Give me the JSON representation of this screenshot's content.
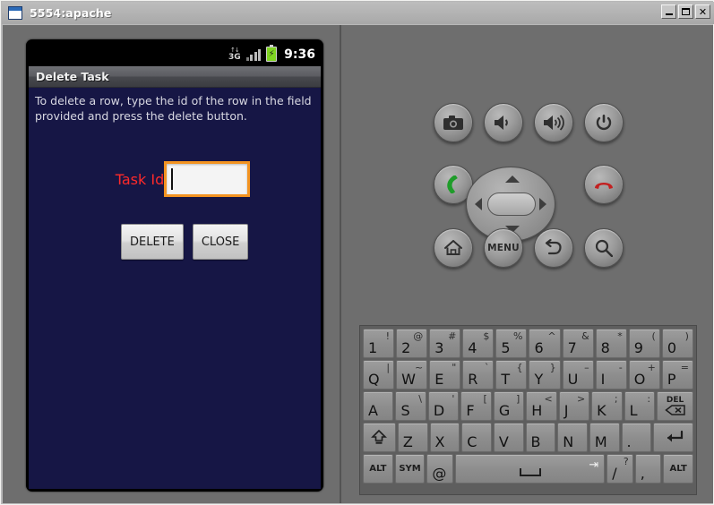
{
  "window": {
    "title": "5554:apache",
    "icon": "window-icon",
    "buttons": [
      {
        "name": "minimize",
        "glyph": "_"
      },
      {
        "name": "maximize",
        "glyph": "□"
      },
      {
        "name": "close",
        "glyph": "✕"
      }
    ]
  },
  "phone": {
    "statusbar": {
      "network_arrows": "↑↓",
      "network_label": "3G",
      "battery_glyph": "⚡",
      "time": "9:36"
    },
    "app": {
      "title": "Delete Task",
      "instructions": "To delete a row, type the id of the row in the field provided and press the delete button.",
      "field_label": "Task Id",
      "field_value": "",
      "field_placeholder": "",
      "buttons": {
        "delete": "DELETE",
        "close": "CLOSE"
      }
    },
    "colors": {
      "background": "#161645",
      "label": "#ff2a2a",
      "focus_border": "#f39321",
      "battery": "#7ed321"
    }
  },
  "controls": {
    "row1": [
      {
        "name": "camera-button",
        "icon": "camera-icon"
      },
      {
        "name": "volume-down-button",
        "icon": "volume-down-icon"
      },
      {
        "name": "volume-up-button",
        "icon": "volume-up-icon"
      },
      {
        "name": "power-button",
        "icon": "power-icon"
      }
    ],
    "row2": [
      {
        "name": "call-button",
        "icon": "phone-green-icon"
      },
      {
        "name": "dpad",
        "icon": "dpad-icon"
      },
      {
        "name": "end-call-button",
        "icon": "phone-red-icon"
      }
    ],
    "row3": [
      {
        "name": "home-button",
        "icon": "home-icon"
      },
      {
        "name": "menu-button",
        "icon": "menu-icon",
        "label": "MENU"
      },
      {
        "name": "back-button",
        "icon": "back-arrow-icon"
      },
      {
        "name": "search-button",
        "icon": "search-icon"
      }
    ]
  },
  "keyboard": {
    "rows": [
      [
        {
          "main": "1",
          "sup": "!"
        },
        {
          "main": "2",
          "sup": "@"
        },
        {
          "main": "3",
          "sup": "#"
        },
        {
          "main": "4",
          "sup": "$"
        },
        {
          "main": "5",
          "sup": "%"
        },
        {
          "main": "6",
          "sup": "^"
        },
        {
          "main": "7",
          "sup": "&"
        },
        {
          "main": "8",
          "sup": "*"
        },
        {
          "main": "9",
          "sup": "("
        },
        {
          "main": "0",
          "sup": ")"
        }
      ],
      [
        {
          "main": "Q",
          "sup": "|"
        },
        {
          "main": "W",
          "sup": "~"
        },
        {
          "main": "E",
          "sup": "\""
        },
        {
          "main": "R",
          "sup": "`"
        },
        {
          "main": "T",
          "sup": "{"
        },
        {
          "main": "Y",
          "sup": "}"
        },
        {
          "main": "U",
          "sup": "–"
        },
        {
          "main": "I",
          "sup": "-"
        },
        {
          "main": "O",
          "sup": "+"
        },
        {
          "main": "P",
          "sup": "="
        }
      ],
      [
        {
          "main": "A",
          "sup": ""
        },
        {
          "main": "S",
          "sup": "\\"
        },
        {
          "main": "D",
          "sup": "'"
        },
        {
          "main": "F",
          "sup": "["
        },
        {
          "main": "G",
          "sup": "]"
        },
        {
          "main": "H",
          "sup": "<"
        },
        {
          "main": "J",
          "sup": ">"
        },
        {
          "main": "K",
          "sup": ";"
        },
        {
          "main": "L",
          "sup": ":"
        },
        {
          "main": "DEL",
          "sup": "",
          "special": "delete"
        }
      ],
      [
        {
          "main": "",
          "sup": "",
          "special": "shift"
        },
        {
          "main": "Z",
          "sup": ""
        },
        {
          "main": "X",
          "sup": ""
        },
        {
          "main": "C",
          "sup": ""
        },
        {
          "main": "V",
          "sup": ""
        },
        {
          "main": "B",
          "sup": ""
        },
        {
          "main": "N",
          "sup": ""
        },
        {
          "main": "M",
          "sup": ""
        },
        {
          "main": ".",
          "sup": ""
        },
        {
          "main": "",
          "sup": "",
          "special": "enter"
        }
      ],
      [
        {
          "main": "ALT",
          "sup": "",
          "special": "alt"
        },
        {
          "main": "SYM",
          "sup": "",
          "special": "sym"
        },
        {
          "main": "@",
          "sup": ""
        },
        {
          "main": "",
          "sup": "",
          "special": "space"
        },
        {
          "main": "/",
          "sup": "?"
        },
        {
          "main": ",",
          "sup": ""
        },
        {
          "main": "ALT",
          "sup": "",
          "special": "alt"
        }
      ]
    ]
  }
}
